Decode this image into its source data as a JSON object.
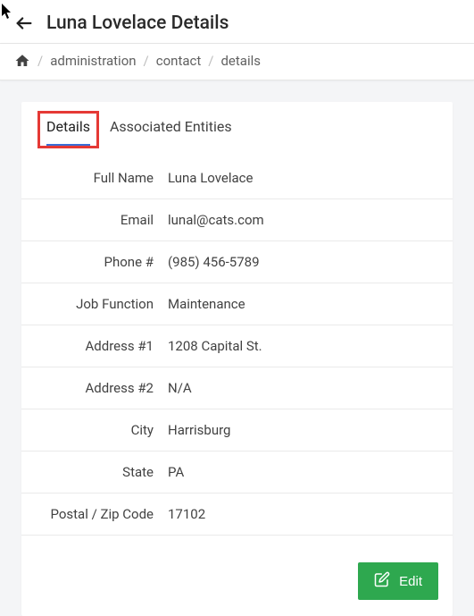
{
  "header": {
    "title": "Luna Lovelace Details"
  },
  "breadcrumb": {
    "items": [
      "administration",
      "contact",
      "details"
    ]
  },
  "tabs": {
    "details": "Details",
    "associated": "Associated Entities"
  },
  "details": [
    {
      "label": "Full Name",
      "value": "Luna Lovelace"
    },
    {
      "label": "Email",
      "value": "lunal@cats.com"
    },
    {
      "label": "Phone #",
      "value": "(985) 456-5789"
    },
    {
      "label": "Job Function",
      "value": "Maintenance"
    },
    {
      "label": "Address #1",
      "value": "1208 Capital St."
    },
    {
      "label": "Address #2",
      "value": "N/A"
    },
    {
      "label": "City",
      "value": "Harrisburg"
    },
    {
      "label": "State",
      "value": "PA"
    },
    {
      "label": "Postal / Zip Code",
      "value": "17102"
    }
  ],
  "footer": {
    "edit_label": "Edit"
  }
}
